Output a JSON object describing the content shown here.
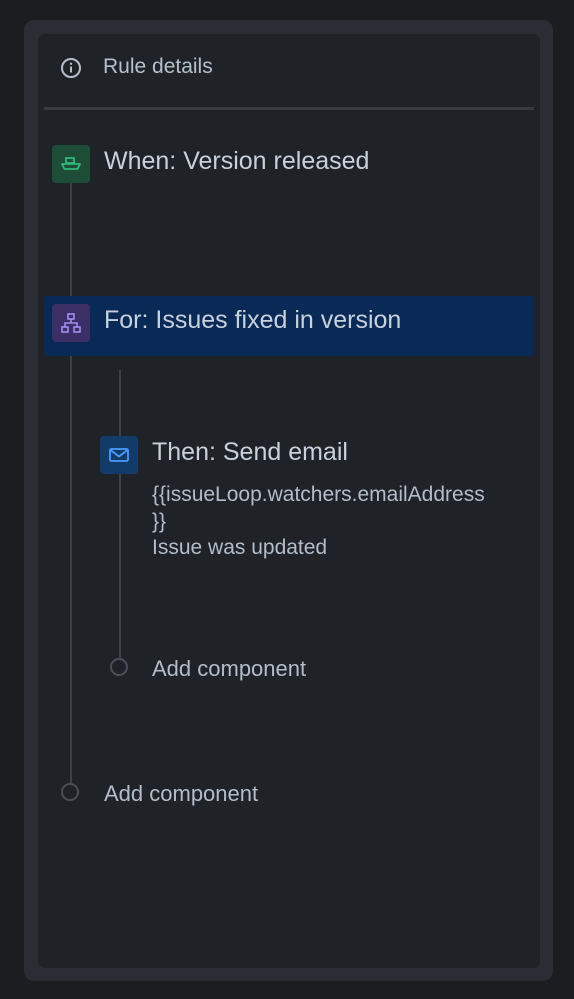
{
  "header": {
    "title": "Rule details",
    "icon": "info-icon"
  },
  "trigger": {
    "label": "When: Version released",
    "icon": "ship-icon",
    "color": "#2fb67c"
  },
  "branch": {
    "label": "For: Issues fixed in version",
    "icon": "branch-icon",
    "color": "#9f8fef",
    "selected": true
  },
  "action": {
    "label": "Then: Send email",
    "icon": "email-icon",
    "color": "#4c9aff",
    "recipient_line1": "{{issueLoop.watchers.emailAddress",
    "recipient_line2": "}}",
    "subject": "Issue was updated"
  },
  "nested_add": {
    "label": "Add component"
  },
  "root_add": {
    "label": "Add component"
  },
  "colors": {
    "background": "#1b1d20",
    "panel": "#1f2227",
    "selected_row": "#092957"
  }
}
